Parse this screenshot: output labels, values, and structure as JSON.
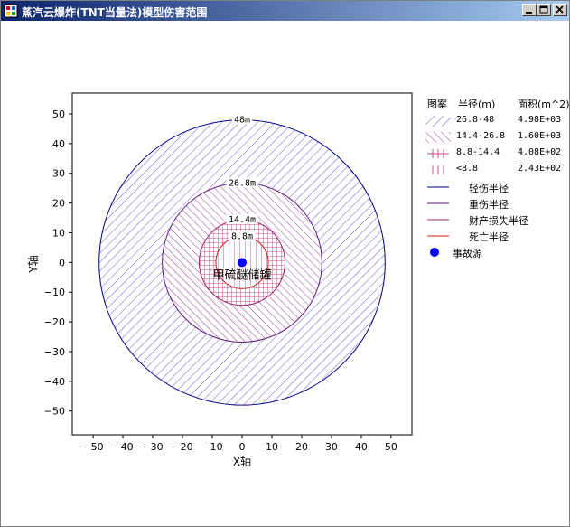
{
  "window": {
    "title": "蒸汽云爆炸(TNT当量法)模型伤害范围"
  },
  "colors": {
    "light": "#00008b",
    "heavy": "#5a1a80",
    "property": "#a0206a",
    "death": "#c81e1e",
    "source": "#0000ff"
  },
  "legend": {
    "headers": [
      "图案",
      "半径(m)",
      "面积(m^2)"
    ],
    "rows": [
      {
        "range": "26.8-48",
        "area": "4.98E+03",
        "pattern": "hatch-light"
      },
      {
        "range": "14.4-26.8",
        "area": "1.60E+03",
        "pattern": "hatch-heavy"
      },
      {
        "range": "8.8-14.4",
        "area": "4.08E+02",
        "pattern": "grid"
      },
      {
        "range": "<8.8",
        "area": "2.43E+02",
        "pattern": "vertical"
      }
    ],
    "lines": [
      "轻伤半径",
      "重伤半径",
      "财产损失半径",
      "死亡半径"
    ],
    "source_label": "事故源"
  },
  "chart_data": {
    "type": "area",
    "xlabel": "X轴",
    "ylabel": "Y轴",
    "xlim": [
      -57,
      57
    ],
    "ylim": [
      -58,
      57
    ],
    "xticks": [
      -50,
      -40,
      -30,
      -20,
      -10,
      0,
      10,
      20,
      30,
      40,
      50
    ],
    "yticks": [
      50,
      40,
      30,
      20,
      10,
      0,
      -10,
      -20,
      -30,
      -40,
      -50
    ],
    "circles": [
      {
        "name": "轻伤半径",
        "radius": 48,
        "label": "48m",
        "pattern": "hatch-light"
      },
      {
        "name": "重伤半径",
        "radius": 26.8,
        "label": "26.8m",
        "pattern": "hatch-heavy"
      },
      {
        "name": "财产损失半径",
        "radius": 14.4,
        "label": "14.4m",
        "pattern": "grid"
      },
      {
        "name": "死亡半径",
        "radius": 8.8,
        "label": "8.8m",
        "pattern": "vertical"
      }
    ],
    "source": {
      "x": 0,
      "y": 0,
      "label": "甲硫醚储罐"
    }
  }
}
